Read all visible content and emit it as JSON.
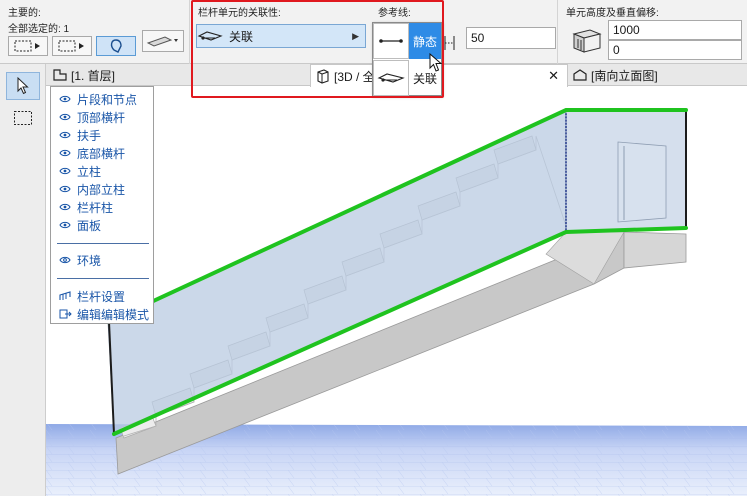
{
  "infobox": {
    "main_title": "主要的:",
    "selected_label": "全部选定的: 1",
    "assoc_title": "栏杆单元的关联性:",
    "assoc_value": "关联",
    "ref_title": "参考线:",
    "ref_options": [
      "静态",
      "关联"
    ],
    "ref_selected": "静态",
    "offset_value": "50",
    "height_title": "单元高度及垂直偏移:",
    "height_value": "1000",
    "vertical_offset": "0"
  },
  "tabs": [
    {
      "label": "[1. 首层]"
    },
    {
      "label": "[3D / 全"
    },
    {
      "label": "[南向立面图]"
    }
  ],
  "context_menu": {
    "items": [
      {
        "label": "片段和节点",
        "icon": "eye-icon"
      },
      {
        "label": "顶部横杆",
        "icon": "eye-icon"
      },
      {
        "label": "扶手",
        "icon": "eye-icon"
      },
      {
        "label": "底部横杆",
        "icon": "eye-icon"
      },
      {
        "label": "立柱",
        "icon": "eye-icon"
      },
      {
        "label": "内部立柱",
        "icon": "eye-icon"
      },
      {
        "label": "栏杆柱",
        "icon": "eye-icon"
      },
      {
        "label": "面板",
        "icon": "eye-icon"
      }
    ],
    "environment": "环境",
    "settings": "栏杆设置",
    "edit_mode": "编辑编辑模式"
  },
  "colors": {
    "highlight": "#e0191f",
    "selection_green": "#1fc31f",
    "accent_blue": "#2e8be6",
    "panel_blue": "#b9cbe2"
  }
}
